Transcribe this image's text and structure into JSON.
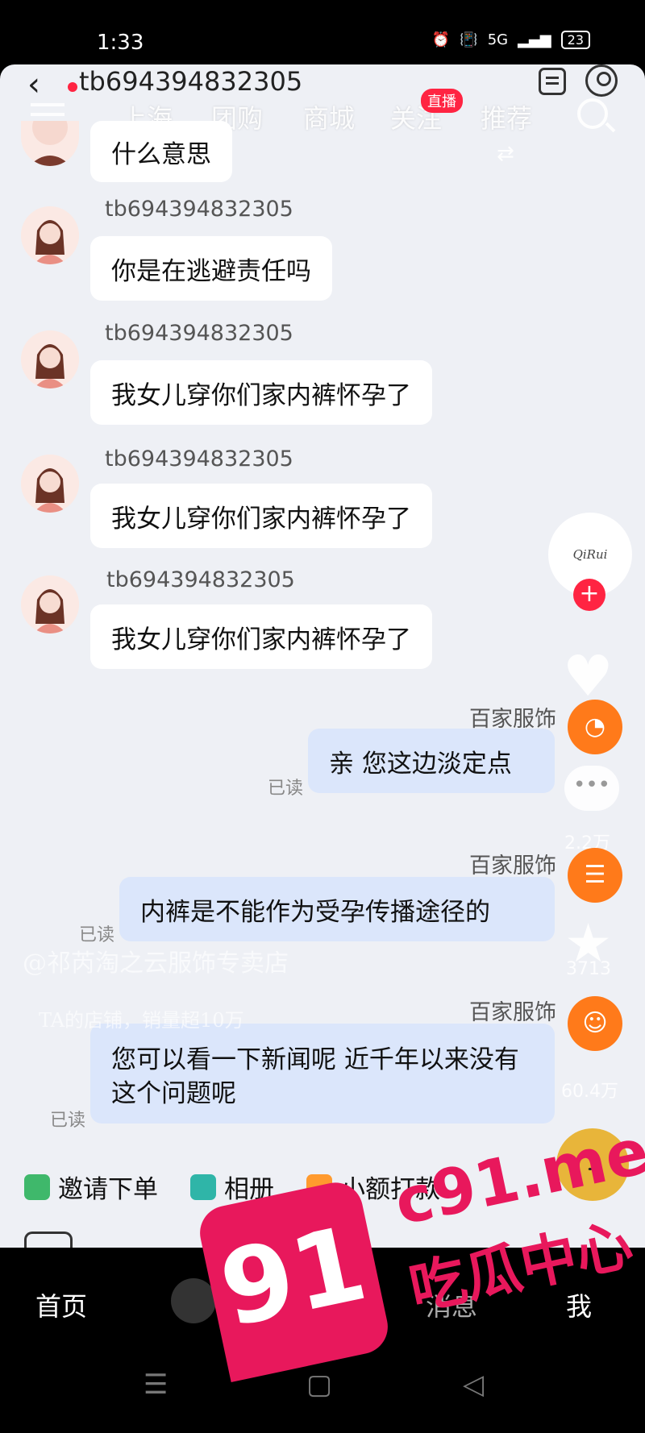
{
  "status_bar": {
    "time": "1:33",
    "network": "5G",
    "battery": "23"
  },
  "chat": {
    "title": "tb694394832305"
  },
  "overlay_nav": {
    "items": [
      "上海",
      "团购",
      "商城",
      "关注",
      "推荐"
    ],
    "live_badge": "直播"
  },
  "messages": [
    {
      "sender": "",
      "text": "什么意思",
      "side": "left"
    },
    {
      "sender": "tb694394832305",
      "text": "你是在逃避责任吗",
      "side": "left"
    },
    {
      "sender": "tb694394832305",
      "text": "我女儿穿你们家内裤怀孕了",
      "side": "left"
    },
    {
      "sender": "tb694394832305",
      "text": "我女儿穿你们家内裤怀孕了",
      "side": "left"
    },
    {
      "sender": "tb694394832305",
      "text": "我女儿穿你们家内裤怀孕了",
      "side": "left"
    },
    {
      "sender": "百家服饰",
      "text": "亲 您这边淡定点",
      "side": "right",
      "status": "已读"
    },
    {
      "sender": "百家服饰",
      "text": "内裤是不能作为受孕传播途径的",
      "side": "right",
      "status": "已读"
    },
    {
      "sender": "百家服饰",
      "text": "您可以看一下新闻呢 近千年以来没有这个问题呢",
      "side": "right",
      "status": "已读"
    }
  ],
  "side_panel": {
    "shop_logo": "QiRui",
    "counts": {
      "comments": "2.2万",
      "stars": "3713",
      "shares": "60.4万"
    }
  },
  "ghost_overlay": {
    "shop_name": "@祁芮淘之云服饰专卖店",
    "shop_stats": "TA的店铺，销量超10万"
  },
  "quick_actions": [
    "邀请下单",
    "相册",
    "小额打款"
  ],
  "tab_bar": {
    "home": "首页",
    "messages": "消息",
    "me": "我"
  },
  "watermark": {
    "number": "91",
    "domain": "c91.me",
    "text": "吃瓜中心"
  },
  "colors": {
    "accent_red": "#ff2442",
    "bubble_right": "#dbe6fb",
    "orange": "#ff7a1a",
    "watermark": "#e8185c"
  }
}
